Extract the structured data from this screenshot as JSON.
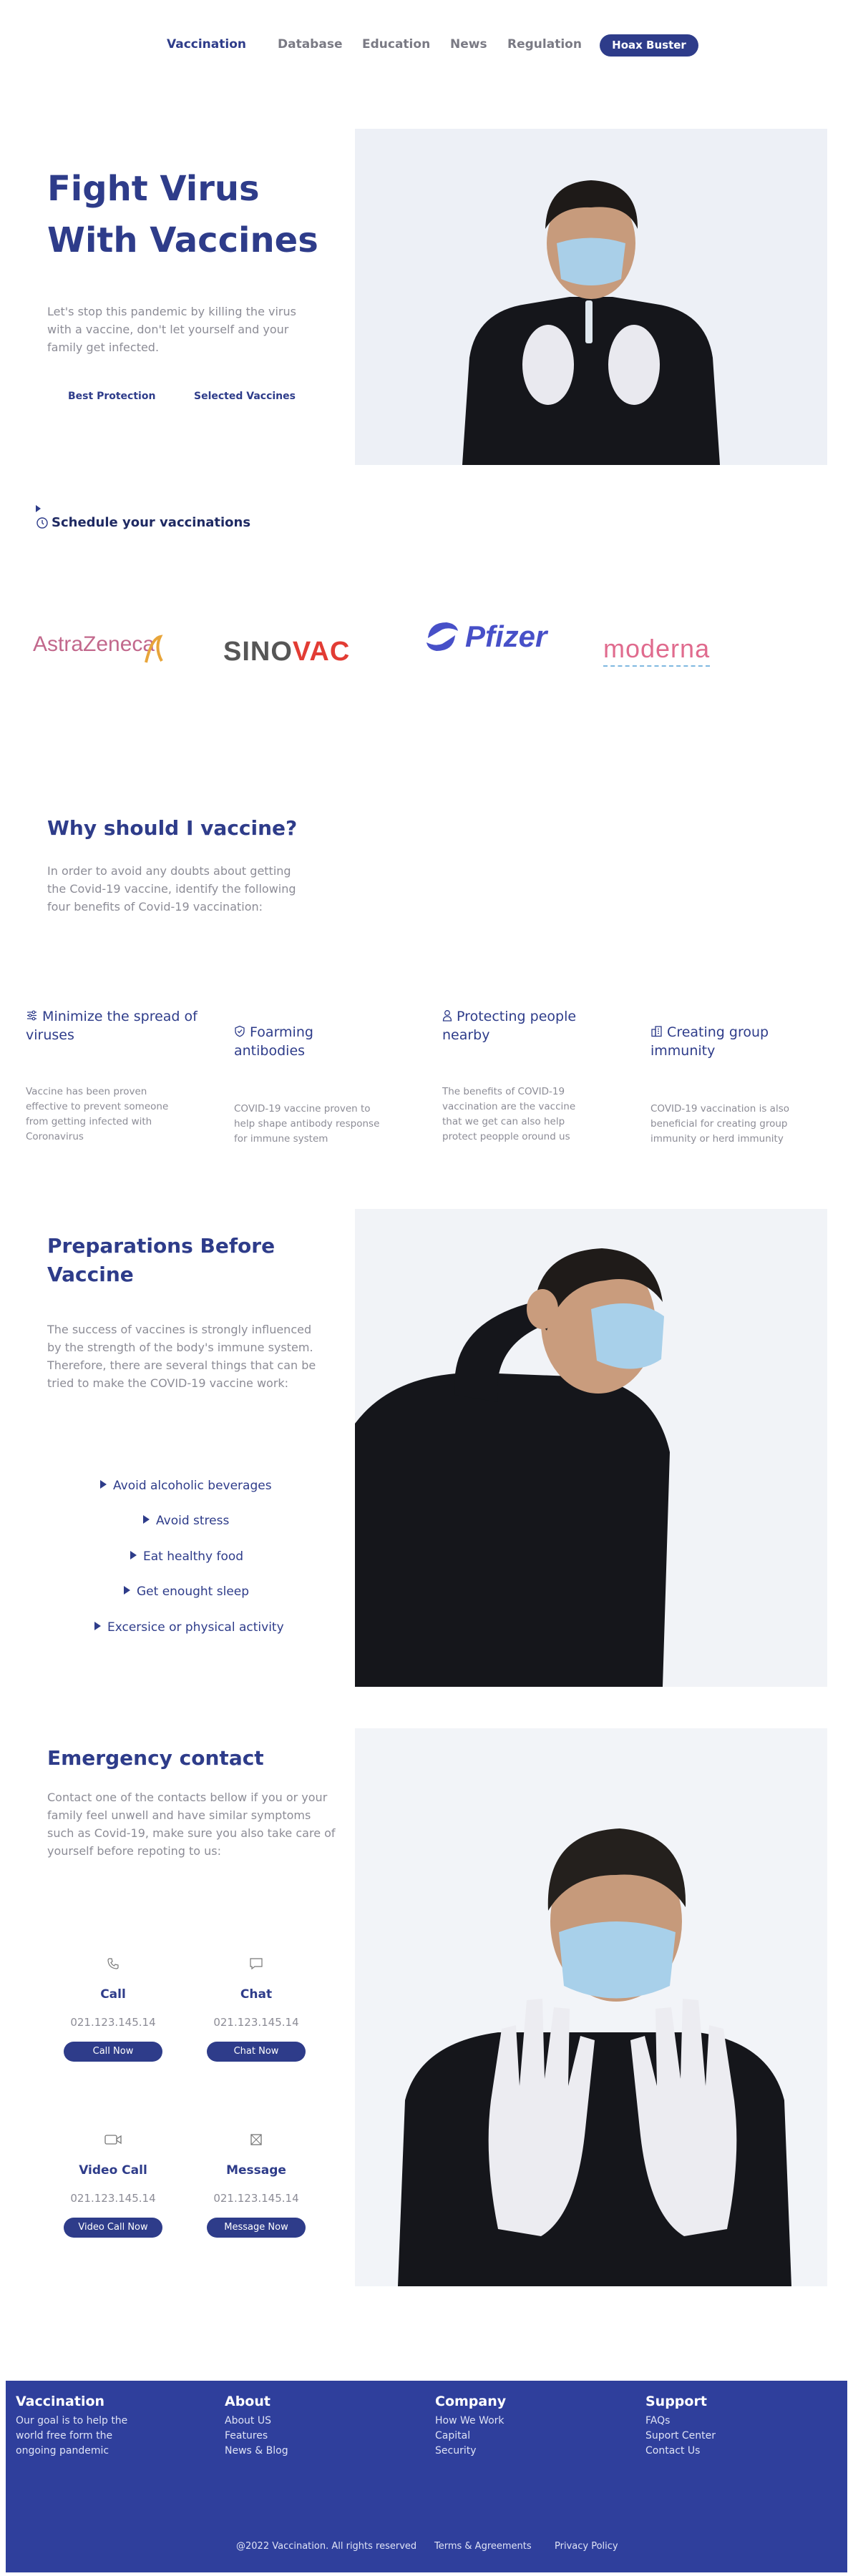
{
  "nav": {
    "items": [
      "Vaccination",
      "Database",
      "Education",
      "News",
      "Regulation"
    ],
    "cta": "Hoax Buster"
  },
  "hero": {
    "title_line1": "Fight Virus",
    "title_line2": "With Vaccines",
    "text": "Let's stop this pandemic by killing the virus with a vaccine, don't let yourself and your family get infected.",
    "link1": "Best Protection",
    "link2": "Selected Vaccines",
    "schedule": "Schedule your vaccinations"
  },
  "brands": [
    "AstraZeneca",
    "SINOVAC",
    "Pfizer",
    "moderna"
  ],
  "why": {
    "title": "Why should I vaccine?",
    "text": "In order to avoid any doubts about getting the Covid-19 vaccine, identify the following four benefits of Covid-19 vaccination:"
  },
  "benefits": [
    {
      "icon": "sliders-icon",
      "title": "Minimize the spread of viruses",
      "text": "Vaccine has been proven effective to prevent someone from getting infected with Coronavirus"
    },
    {
      "icon": "shield-check-icon",
      "title": "Foarming antibodies",
      "text": "COVID-19 vaccine proven to help shape antibody response for immune system"
    },
    {
      "icon": "person-icon",
      "title": "Protecting people nearby",
      "text": "The benefits of COVID-19 vaccination are the vaccine that we get can also help protect peopple oround us"
    },
    {
      "icon": "building-icon",
      "title": "Creating group immunity",
      "text": "COVID-19 vaccination is also beneficial for creating group immunity or herd immunity"
    }
  ],
  "prep": {
    "title_line1": "Preparations Before",
    "title_line2": "Vaccine",
    "text": "The success of vaccines is strongly influenced by the strength of the body's immune system. Therefore, there are several things that can be tried to make the COVID-19 vaccine work:",
    "items": [
      "Avoid alcoholic beverages",
      "Avoid stress",
      "Eat healthy food",
      "Get enought sleep",
      "Excersice or physical activity"
    ]
  },
  "emergency": {
    "title": "Emergency contact",
    "text": "Contact one of the contacts bellow if you or your family feel unwell and have similar symptoms such as Covid-19, make sure you also take care of yourself before repoting to us:",
    "contacts": [
      {
        "icon": "phone-icon",
        "title": "Call",
        "number": "021.123.145.14",
        "button": "Call Now"
      },
      {
        "icon": "chat-icon",
        "title": "Chat",
        "number": "021.123.145.14",
        "button": "Chat Now"
      },
      {
        "icon": "video-icon",
        "title": "Video Call",
        "number": "021.123.145.14",
        "button": "Video Call Now"
      },
      {
        "icon": "mail-icon",
        "title": "Message",
        "number": "021.123.145.14",
        "button": "Message Now"
      }
    ]
  },
  "footer": {
    "cols": [
      {
        "title": "Vaccination",
        "lines": [
          "Our goal is to help the",
          "world free form the",
          "ongoing pandemic"
        ]
      },
      {
        "title": "About",
        "lines": [
          "About US",
          "Features",
          "News & Blog"
        ]
      },
      {
        "title": "Company",
        "lines": [
          "How We Work",
          "Capital",
          "Security"
        ]
      },
      {
        "title": "Support",
        "lines": [
          "FAQs",
          "Suport Center",
          "Contact Us"
        ]
      }
    ],
    "copyright": "@2022 Vaccination. All rights reserved",
    "terms": "Terms & Agreements",
    "privacy": "Privacy Policy"
  },
  "colors": {
    "primary": "#2e3c8a",
    "footer": "#2f3f9c",
    "muted": "#8c8c96"
  }
}
